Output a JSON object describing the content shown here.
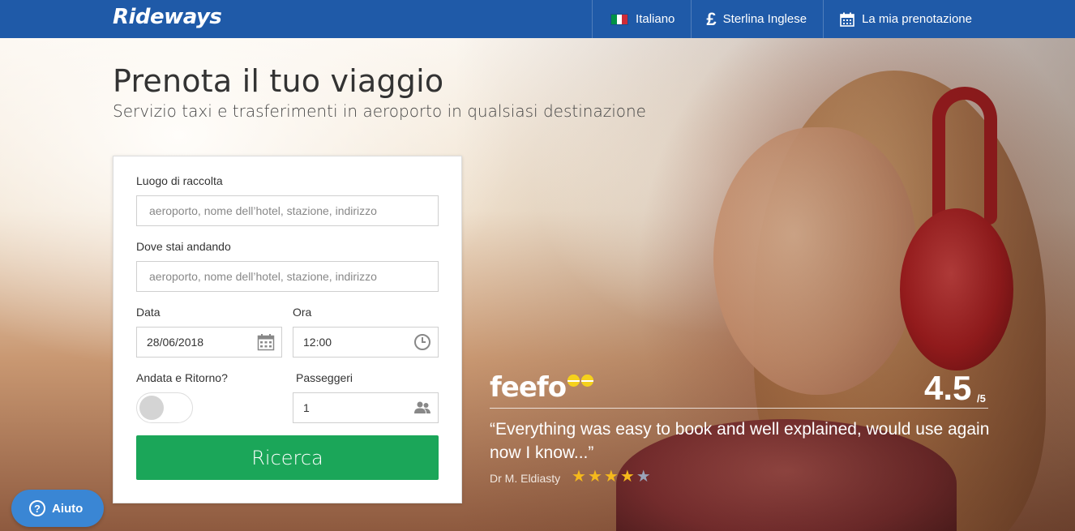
{
  "header": {
    "logo": "Rideways",
    "language": "Italiano",
    "currency_symbol": "£",
    "currency": "Sterlina Inglese",
    "booking": "La mia prenotazione"
  },
  "hero": {
    "title": "Prenota il tuo viaggio",
    "subtitle": "Servizio taxi e trasferimenti in aeroporto in qualsiasi destinazione"
  },
  "form": {
    "pickup_label": "Luogo di raccolta",
    "pickup_placeholder": "aeroporto, nome dell’hotel, stazione, indirizzo",
    "dropoff_label": "Dove stai andando",
    "dropoff_placeholder": "aeroporto, nome dell’hotel, stazione, indirizzo",
    "date_label": "Data",
    "date_value": "28/06/2018",
    "time_label": "Ora",
    "time_value": "12:00",
    "return_label": "Andata e Ritorno?",
    "return_on": false,
    "passengers_label": "Passeggeri",
    "passengers_value": "1",
    "search_button": "Ricerca"
  },
  "review": {
    "brand": "feefo",
    "rating": "4.5",
    "rating_out_of": "/5",
    "quote": "“Everything was easy to book and well explained, would use again now I know...”",
    "author": "Dr M. Eldiasty",
    "stars_filled": 4,
    "stars_total": 5
  },
  "help": {
    "label": "Aiuto"
  },
  "colors": {
    "header_bg": "#1f5aa8",
    "search_button": "#1ba659",
    "help_button": "#3a86d4",
    "star_on": "#f5b91c"
  }
}
